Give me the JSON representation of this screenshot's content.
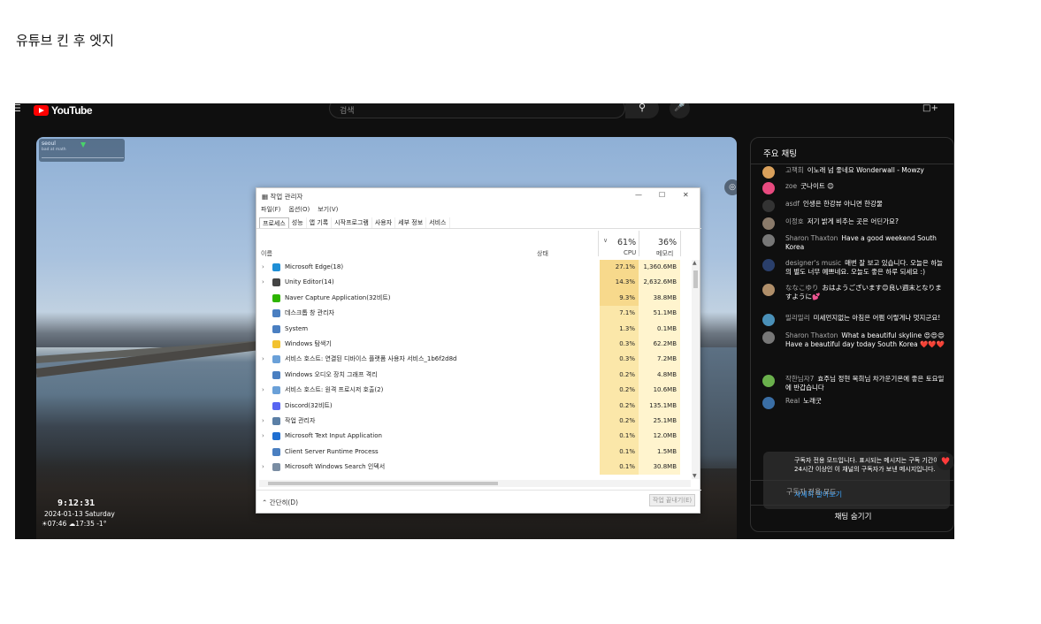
{
  "post_title": "유튜브 킨 후 엣지",
  "youtube": {
    "logo_text": "YouTube",
    "search_placeholder": "검색",
    "menu_icon": "menu-icon",
    "search_icon": "search-icon",
    "mic_icon": "mic-icon",
    "create_icon": "create-icon"
  },
  "video": {
    "overlay_title": "seoul",
    "overlay_sub": "bad at math",
    "clock": "9:12:31",
    "date": "2024-01-13 Saturday",
    "sun": "☀07:46 ☁17:35 -1°"
  },
  "task_manager": {
    "title": "작업 관리자",
    "menu": [
      "파일(F)",
      "옵션(O)",
      "보기(V)"
    ],
    "tabs": [
      "프로세스",
      "성능",
      "앱 기록",
      "시작프로그램",
      "사용자",
      "세부 정보",
      "서비스"
    ],
    "col_name": "이름",
    "col_status": "상태",
    "cpu_pct": "61%",
    "mem_pct": "36%",
    "col_cpu": "CPU",
    "col_mem": "메모리",
    "rows": [
      {
        "name": "Microsoft Edge(18)",
        "cpu": "27.1%",
        "mem": "1,360.6MB",
        "expand": true,
        "color": "#1f8fd6"
      },
      {
        "name": "Unity Editor(14)",
        "cpu": "14.3%",
        "mem": "2,632.6MB",
        "expand": true,
        "color": "#444444"
      },
      {
        "name": "Naver Capture Application(32비트)",
        "cpu": "9.3%",
        "mem": "38.8MB",
        "expand": false,
        "color": "#2db400"
      },
      {
        "name": "데스크톱 창 관리자",
        "cpu": "7.1%",
        "mem": "51.1MB",
        "expand": false,
        "color": "#4a7fc1"
      },
      {
        "name": "System",
        "cpu": "1.3%",
        "mem": "0.1MB",
        "expand": false,
        "color": "#4a7fc1"
      },
      {
        "name": "Windows 탐색기",
        "cpu": "0.3%",
        "mem": "62.2MB",
        "expand": false,
        "color": "#f2c230"
      },
      {
        "name": "서비스 호스트: 연결된 디바이스 플랫폼 사용자 서비스_1b6f2d8d",
        "cpu": "0.3%",
        "mem": "7.2MB",
        "expand": true,
        "color": "#6aa0d8"
      },
      {
        "name": "Windows 오디오 장치 그래프 격리",
        "cpu": "0.2%",
        "mem": "4.8MB",
        "expand": false,
        "color": "#4a7fc1"
      },
      {
        "name": "서비스 호스트: 원격 프로시저 호출(2)",
        "cpu": "0.2%",
        "mem": "10.6MB",
        "expand": true,
        "color": "#6aa0d8"
      },
      {
        "name": "Discord(32비트)",
        "cpu": "0.2%",
        "mem": "135.1MB",
        "expand": false,
        "color": "#5865f2"
      },
      {
        "name": "작업 관리자",
        "cpu": "0.2%",
        "mem": "25.1MB",
        "expand": true,
        "color": "#5b7fa6"
      },
      {
        "name": "Microsoft Text Input Application",
        "cpu": "0.1%",
        "mem": "12.0MB",
        "expand": true,
        "color": "#1f6fd1"
      },
      {
        "name": "Client Server Runtime Process",
        "cpu": "0.1%",
        "mem": "1.5MB",
        "expand": false,
        "color": "#4a7fc1"
      },
      {
        "name": "Microsoft Windows Search 인덱서",
        "cpu": "0.1%",
        "mem": "30.8MB",
        "expand": true,
        "color": "#7a8da3"
      }
    ],
    "fewer_details": "간단히(D)",
    "end_task": "작업 끝내기(E)"
  },
  "chat": {
    "title": "주요 채팅",
    "messages": [
      {
        "author": "고책희",
        "text": "이노래 넘 좋네요 Wonderwall - Mowzy",
        "color": "#d9a05b"
      },
      {
        "author": "zoe",
        "text": "굿나이트 😊",
        "color": "#e84a7f"
      },
      {
        "author": "asdf",
        "text": "인생은 한강뷰 아니면 한강물",
        "color": "#333333"
      },
      {
        "author": "이정호",
        "text": "저기 밝게 비추는 곳은 어딘가요?",
        "color": "#8a7a6a"
      },
      {
        "author": "Sharon Thaxton",
        "text": "Have a good weekend South Korea",
        "color": "#777777"
      },
      {
        "author": "designer's music",
        "text": "매번 잘 보고 있습니다. 오늘은 하늘의 별도 너무 예쁘네요. 오늘도 좋은 하루 되세요 :)",
        "color": "#2a3f6b"
      },
      {
        "author": "ななこゆり",
        "text": "おはようございます😊良い週末となりますように💕",
        "color": "#b08f6a"
      },
      {
        "author": "밀리밀리",
        "text": "미세먼지없는 아침은 어쩜 이렇게나 멋지군요!",
        "color": "#4a90b8"
      },
      {
        "author": "Sharon Thaxton",
        "text": "What a beautiful skyline 😍😍😍 Have a beautiful day today South Korea ❤️❤️❤️",
        "color": "#777777"
      },
      {
        "author": "작한님자7",
        "text": "효주님 정현 목희님 차가운기온에 좋은 토요일에 반갑습니다",
        "color": "#6ab04c"
      },
      {
        "author": "Real",
        "text": "노래굿",
        "color": "#3a6ea5"
      }
    ],
    "notice": "구독자 전용 모드입니다. 표시되는 메시지는 구독 기간이 24시간 이상인 이 채널의 구독자가 보낸 메시지입니다.",
    "learn_more": "자세히 알아보기",
    "subscriber_mode": "구독자 전용 모드",
    "hide_chat": "채팅 숨기기"
  }
}
